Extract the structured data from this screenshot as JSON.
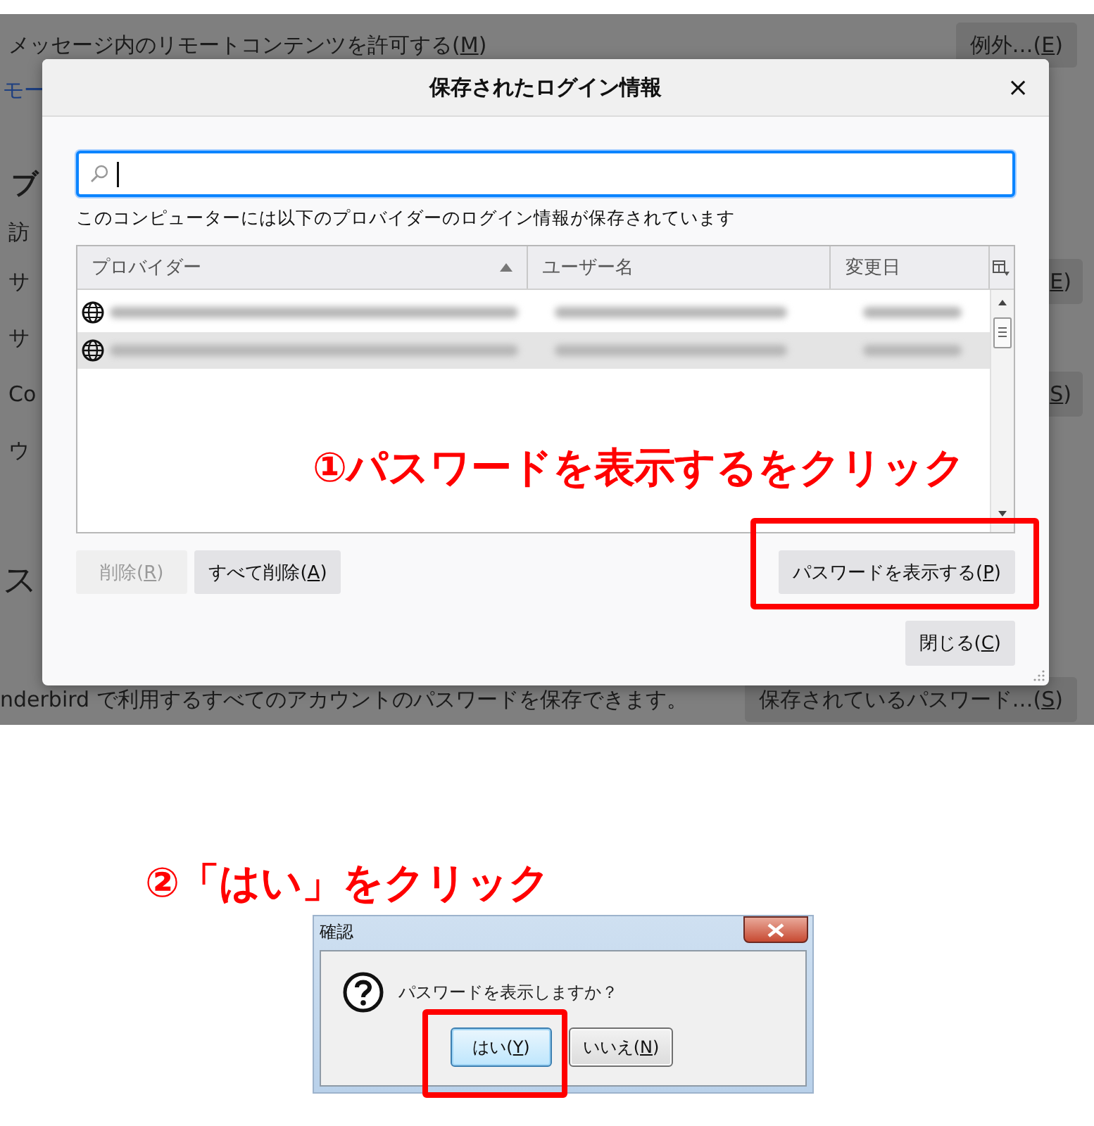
{
  "settings_page": {
    "remote_content": {
      "label": "メッセージ内のリモートコンテンツを許可する(",
      "access_key": "M",
      "suffix": ")",
      "button": {
        "label": "例外…(",
        "access_key": "E",
        "suffix": ")"
      }
    },
    "link": "モー",
    "heading": "ブ",
    "items": [
      {
        "label": "訪"
      },
      {
        "label": "サ",
        "button": {
          "access_key": "E",
          "suffix": ")"
        }
      },
      {
        "label": "サ"
      },
      {
        "label": "Co",
        "button": {
          "access_key": "S",
          "suffix": ")"
        }
      },
      {
        "label": "ウ"
      }
    ],
    "password_heading": "ス",
    "password_note": "nderbird で利用するすべてのアカウントのパスワードを保存できます。",
    "password_button": {
      "label": "保存されているパスワード…(",
      "access_key": "S",
      "suffix": ")"
    }
  },
  "login_dialog": {
    "title": "保存されたログイン情報",
    "close": "×",
    "search": {
      "focused": true
    },
    "description": "このコンピューターには以下のプロバイダーのログイン情報が保存されています",
    "table": {
      "columns": [
        {
          "label": "プロバイダー",
          "sorted": true
        },
        {
          "label": "ユーザー名",
          "sorted": false
        },
        {
          "label": "変更日",
          "sorted": false
        }
      ],
      "rows": [
        {
          "selected": false
        },
        {
          "selected": true
        }
      ]
    },
    "buttons": [
      {
        "label": "削除(",
        "access_key": "R",
        "suffix": ")",
        "disabled": true
      },
      {
        "label": "すべて削除(",
        "access_key": "A",
        "suffix": ")",
        "disabled": false
      },
      {
        "label": "パスワードを表示する(",
        "access_key": "P",
        "suffix": ")",
        "disabled": false
      }
    ],
    "close_button": {
      "label": "閉じる(",
      "access_key": "C",
      "suffix": ")"
    }
  },
  "callouts": [
    {
      "text": "①パスワードを表示するをクリック"
    },
    {
      "text": "②「はい」をクリック"
    }
  ],
  "confirm_dialog": {
    "title": "確認",
    "message": "パスワードを表示しますか？",
    "buttons": [
      {
        "label": "はい(",
        "access_key": "Y",
        "suffix": ")",
        "default": true
      },
      {
        "label": "いいえ(",
        "access_key": "N",
        "suffix": ")",
        "default": false
      }
    ]
  }
}
